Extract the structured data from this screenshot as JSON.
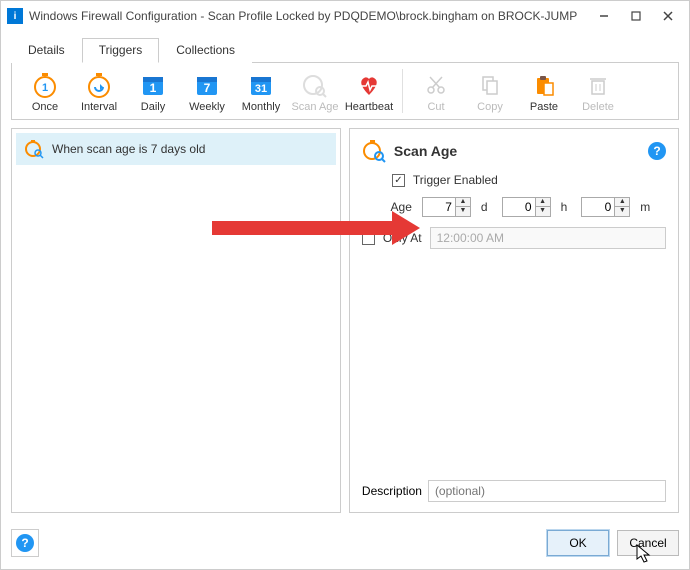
{
  "window": {
    "title": "Windows Firewall Configuration - Scan Profile Locked by PDQDEMO\\brock.bingham on BROCK-JUMP"
  },
  "tabs": {
    "items": [
      "Details",
      "Triggers",
      "Collections"
    ],
    "active_index": 1
  },
  "toolbar": {
    "items": [
      {
        "label": "Once",
        "enabled": true
      },
      {
        "label": "Interval",
        "enabled": true
      },
      {
        "label": "Daily",
        "enabled": true
      },
      {
        "label": "Weekly",
        "enabled": true
      },
      {
        "label": "Monthly",
        "enabled": true
      },
      {
        "label": "Scan Age",
        "enabled": false
      },
      {
        "label": "Heartbeat",
        "enabled": true
      },
      {
        "label": "Cut",
        "enabled": false
      },
      {
        "label": "Copy",
        "enabled": false
      },
      {
        "label": "Paste",
        "enabled": true
      },
      {
        "label": "Delete",
        "enabled": false
      }
    ]
  },
  "trigger_list": {
    "items": [
      "When scan age is 7 days old"
    ]
  },
  "panel": {
    "title": "Scan Age",
    "trigger_enabled_label": "Trigger Enabled",
    "trigger_enabled": true,
    "age_label": "Age",
    "age_days": "7",
    "age_hours": "0",
    "age_minutes": "0",
    "unit_d": "d",
    "unit_h": "h",
    "unit_m": "m",
    "only_at_label": "Only At",
    "only_at_checked": false,
    "only_at_time": "12:00:00 AM",
    "description_label": "Description",
    "description_placeholder": "(optional)"
  },
  "footer": {
    "ok": "OK",
    "cancel": "Cancel"
  }
}
